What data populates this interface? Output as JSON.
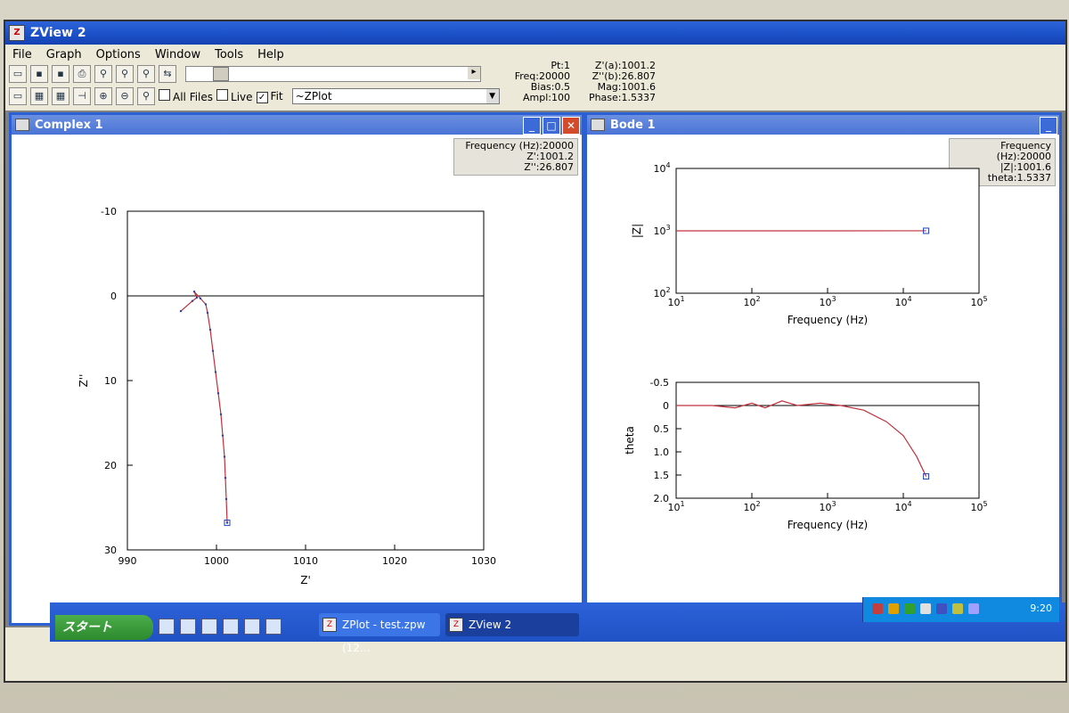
{
  "app": {
    "title": "ZView 2",
    "icon": "zview-app-icon"
  },
  "menu": [
    "File",
    "Graph",
    "Options",
    "Window",
    "Tools",
    "Help"
  ],
  "toolbar": {
    "checkboxes": [
      {
        "label": "All Files",
        "checked": false
      },
      {
        "label": "Live",
        "checked": false
      },
      {
        "label": "Fit",
        "checked": true
      }
    ],
    "fit_model": "~ZPlot"
  },
  "status": {
    "pt": "Pt:1",
    "freq": "Freq:20000",
    "bias": "Bias:0.5",
    "ampl": "Ampl:100",
    "z_a": "Z'(a):1001.2",
    "z_b": "Z''(b):26.807",
    "mag": "Mag:1001.6",
    "phase": "Phase:1.5337"
  },
  "complex_window": {
    "title": "Complex 1",
    "info": {
      "line1": "Frequency (Hz):20000",
      "line2": "Z':1001.2",
      "line3": "Z'':26.807"
    },
    "chart_data": {
      "type": "line",
      "xlabel": "Z'",
      "ylabel": "Z''",
      "xlim": [
        990,
        1030
      ],
      "ylim": [
        -10,
        30
      ],
      "x_ticks": [
        "990",
        "1000",
        "1010",
        "1020",
        "1030"
      ],
      "y_ticks": [
        "-10",
        "0",
        "10",
        "20",
        "30"
      ],
      "y_inverted": true,
      "series": [
        {
          "color": "#c0303c",
          "points": [
            [
              996.0,
              1.8
            ],
            [
              997.3,
              0.6
            ],
            [
              997.8,
              0.2
            ],
            [
              997.5,
              -0.5
            ],
            [
              998.2,
              0.3
            ],
            [
              998.8,
              1.0
            ],
            [
              999.0,
              2.0
            ],
            [
              999.3,
              4.0
            ],
            [
              999.6,
              6.5
            ],
            [
              999.9,
              9.0
            ],
            [
              1000.2,
              11.5
            ],
            [
              1000.5,
              14.0
            ],
            [
              1000.7,
              16.5
            ],
            [
              1000.9,
              19.0
            ],
            [
              1001.0,
              21.5
            ],
            [
              1001.1,
              24.0
            ],
            [
              1001.2,
              26.8
            ]
          ]
        }
      ],
      "marker_point": [
        1001.2,
        26.8
      ]
    }
  },
  "bode_window": {
    "title": "Bode 1",
    "info": {
      "line1": "Frequency (Hz):20000",
      "line2": "|Z|:1001.6",
      "line3": "theta:1.5337"
    },
    "magnitude_chart": {
      "type": "line",
      "xlabel": "Frequency (Hz)",
      "ylabel": "|Z|",
      "x_log": true,
      "y_log": true,
      "xlim": [
        10,
        100000
      ],
      "ylim": [
        100,
        10000
      ],
      "x_tick_exps": [
        "1",
        "2",
        "3",
        "4",
        "5"
      ],
      "y_tick_exps": [
        "2",
        "3",
        "4"
      ],
      "tick_base": "10",
      "series": [
        {
          "color": "#c0303c",
          "points": [
            [
              10,
              1000
            ],
            [
              100,
              1001
            ],
            [
              1000,
              1001.2
            ],
            [
              10000,
              1001.4
            ],
            [
              20000,
              1001.6
            ]
          ]
        }
      ],
      "marker_point": [
        20000,
        1001.6
      ]
    },
    "phase_chart": {
      "type": "line",
      "xlabel": "Frequency (Hz)",
      "ylabel": "theta",
      "x_log": true,
      "xlim": [
        10,
        100000
      ],
      "ylim": [
        -0.5,
        2.0
      ],
      "y_inverted": true,
      "x_tick_exps": [
        "1",
        "2",
        "3",
        "4",
        "5"
      ],
      "y_ticks": [
        "-0.5",
        "0",
        "0.5",
        "1.0",
        "1.5",
        "2.0"
      ],
      "tick_base": "10",
      "series": [
        {
          "color": "#c0303c",
          "points": [
            [
              10,
              0.0
            ],
            [
              30,
              0.0
            ],
            [
              60,
              0.05
            ],
            [
              100,
              -0.05
            ],
            [
              150,
              0.05
            ],
            [
              250,
              -0.1
            ],
            [
              400,
              0.0
            ],
            [
              800,
              -0.05
            ],
            [
              1500,
              0.0
            ],
            [
              3000,
              0.1
            ],
            [
              6000,
              0.35
            ],
            [
              10000,
              0.65
            ],
            [
              15000,
              1.1
            ],
            [
              20000,
              1.53
            ]
          ]
        }
      ],
      "marker_point": [
        20000,
        1.53
      ]
    }
  },
  "taskbar": {
    "start_label": "スタート",
    "tasks": [
      {
        "label": "ZPlot - test.zpw (12...",
        "active": false
      },
      {
        "label": "ZView 2",
        "active": true
      }
    ],
    "clock": "9:20"
  }
}
